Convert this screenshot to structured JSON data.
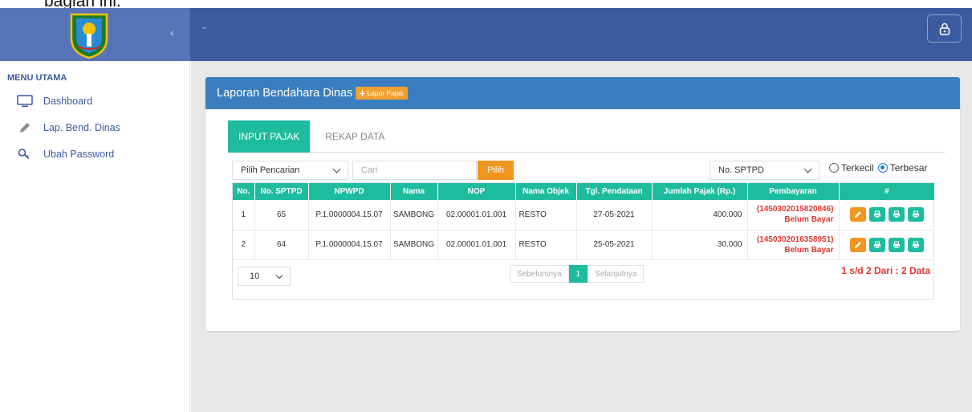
{
  "caption": "bagian ini.",
  "sidebar": {
    "heading": "MENU UTAMA",
    "items": [
      {
        "label": "Dashboard",
        "icon": "monitor-icon"
      },
      {
        "label": "Lap. Bend. Dinas",
        "icon": "pencil-icon"
      },
      {
        "label": "Ubah Password",
        "icon": "key-icon"
      }
    ]
  },
  "topbar": {
    "collapse_icon": "‹",
    "chevron_icon": "⌄"
  },
  "panel": {
    "title": "Laporan Bendahara Dinas",
    "lapor_button": "Lapor Pajak",
    "tabs": [
      "INPUT PAJAK",
      "REKAP DATA"
    ],
    "filters": {
      "search_type": "Pilih Pencarian",
      "search_placeholder": "Cari",
      "pilih_button": "Pilih",
      "sort_field": "No. SPTPD",
      "sort_options": [
        "Terkecil",
        "Terbesar"
      ],
      "sort_selected": "Terbesar"
    },
    "table": {
      "columns": [
        "No.",
        "No. SPTPD",
        "NPWPD",
        "Nama",
        "NOP",
        "Nama Objek",
        "Tgl. Pendataan",
        "Jumlah Pajak (Rp.)",
        "Pembayaran",
        "#"
      ],
      "rows": [
        {
          "no": "1",
          "sptpd": "65",
          "npwpd": "P.1.0000004.15.07",
          "nama": "SAMBONG",
          "nop": "02.00001.01.001",
          "objek": "RESTO",
          "tgl": "27-05-2021",
          "jumlah": "400.000",
          "kode": "(1450302015820846)",
          "status": "Belum Bayar"
        },
        {
          "no": "2",
          "sptpd": "64",
          "npwpd": "P.1.0000004.15.07",
          "nama": "SAMBONG",
          "nop": "02.00001.01.001",
          "objek": "RESTO",
          "tgl": "25-05-2021",
          "jumlah": "30.000",
          "kode": "(1450302016358951)",
          "status": "Belum Bayar"
        }
      ]
    },
    "pagination": {
      "page_size": "10",
      "prev": "Sebelumnya",
      "current": "1",
      "next": "Selanjutnya",
      "summary": "1 s/d 2 Dari : 2 Data"
    }
  },
  "colors": {
    "topbar": "#3c5aa0",
    "brand": "#5874b8",
    "panel_header": "#3a7ebf",
    "teal": "#1ebc9f",
    "orange": "#f0961e",
    "red": "#e0362e"
  }
}
